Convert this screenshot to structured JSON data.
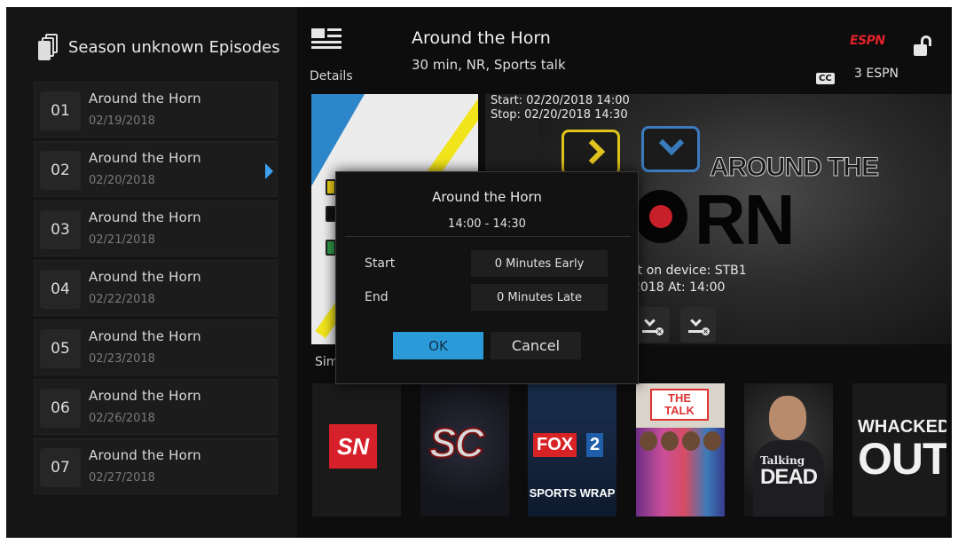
{
  "sidebar": {
    "title": "Season unknown Episodes",
    "episodes": [
      {
        "num": "01",
        "title": "Around the Horn",
        "date": "02/19/2018"
      },
      {
        "num": "02",
        "title": "Around the Horn",
        "date": "02/20/2018"
      },
      {
        "num": "03",
        "title": "Around the Horn",
        "date": "02/21/2018"
      },
      {
        "num": "04",
        "title": "Around the Horn",
        "date": "02/22/2018"
      },
      {
        "num": "05",
        "title": "Around the Horn",
        "date": "02/23/2018"
      },
      {
        "num": "06",
        "title": "Around the Horn",
        "date": "02/26/2018"
      },
      {
        "num": "07",
        "title": "Around the Horn",
        "date": "02/27/2018"
      }
    ],
    "selected_index": 1
  },
  "header": {
    "details_label": "Details",
    "title": "Around the Horn",
    "meta": "30 min, NR, Sports talk",
    "network_logo": "ESPN",
    "cc_badge": "CC",
    "channel": "3 ESPN",
    "lock_icon": "unlocked-padlock-icon"
  },
  "hero": {
    "start": "Start: 02/20/2018 14:00",
    "stop": "Stop: 02/20/2018 14:30",
    "logo_line1": "AROUND THE",
    "logo_line2": "RN",
    "device_line1": "rt on device: STB1",
    "device_line2": "2018 At: 14:00"
  },
  "similar_label": "Sim",
  "thumbnails": [
    {
      "name": "SN"
    },
    {
      "name": "SC"
    },
    {
      "name": "FOX",
      "badge": "2",
      "subtitle": "SPORTS WRAP"
    },
    {
      "name": "THE TALK"
    },
    {
      "line1": "Talking",
      "line2": "DEAD"
    },
    {
      "line1": "WHACKED",
      "line2": "OUT"
    }
  ],
  "dialog": {
    "title": "Around the Horn",
    "time": "14:00 - 14:30",
    "start_label": "Start",
    "start_value": "0 Minutes Early",
    "end_label": "End",
    "end_value": "0 Minutes Late",
    "ok_label": "OK",
    "cancel_label": "Cancel"
  },
  "colors": {
    "accent": "#2a9bd8",
    "espn_red": "#e2222a"
  }
}
